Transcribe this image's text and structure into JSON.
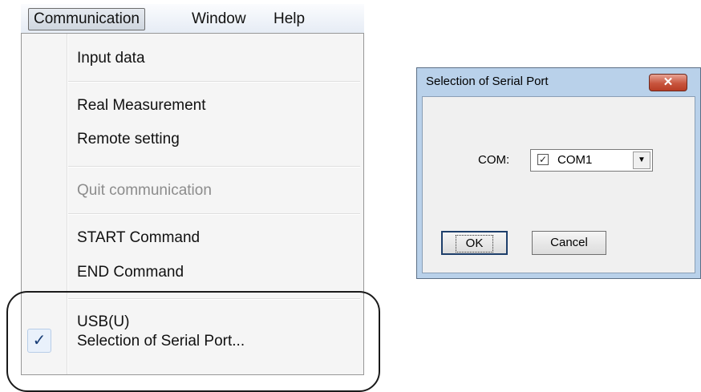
{
  "menubar": {
    "items": [
      {
        "label": "Communication"
      },
      {
        "label": "Window"
      },
      {
        "label": "Help"
      }
    ]
  },
  "communication_menu": {
    "items": [
      {
        "label": "Input data",
        "enabled": true
      },
      {
        "label": "Real Measurement",
        "enabled": true
      },
      {
        "label": "Remote setting",
        "enabled": true
      },
      {
        "label": "Quit communication",
        "enabled": false
      },
      {
        "label": "START Command",
        "enabled": true
      },
      {
        "label": "END Command",
        "enabled": true
      },
      {
        "label": "USB(U)",
        "enabled": true
      },
      {
        "label": "Selection of Serial Port...",
        "enabled": true,
        "checked": true
      }
    ],
    "check_mark": "✓"
  },
  "dialog": {
    "title": "Selection of Serial Port",
    "close_glyph": "✕",
    "com_label": "COM:",
    "com_value": "COM1",
    "com_checked": true,
    "ok_label": "OK",
    "cancel_label": "Cancel"
  }
}
